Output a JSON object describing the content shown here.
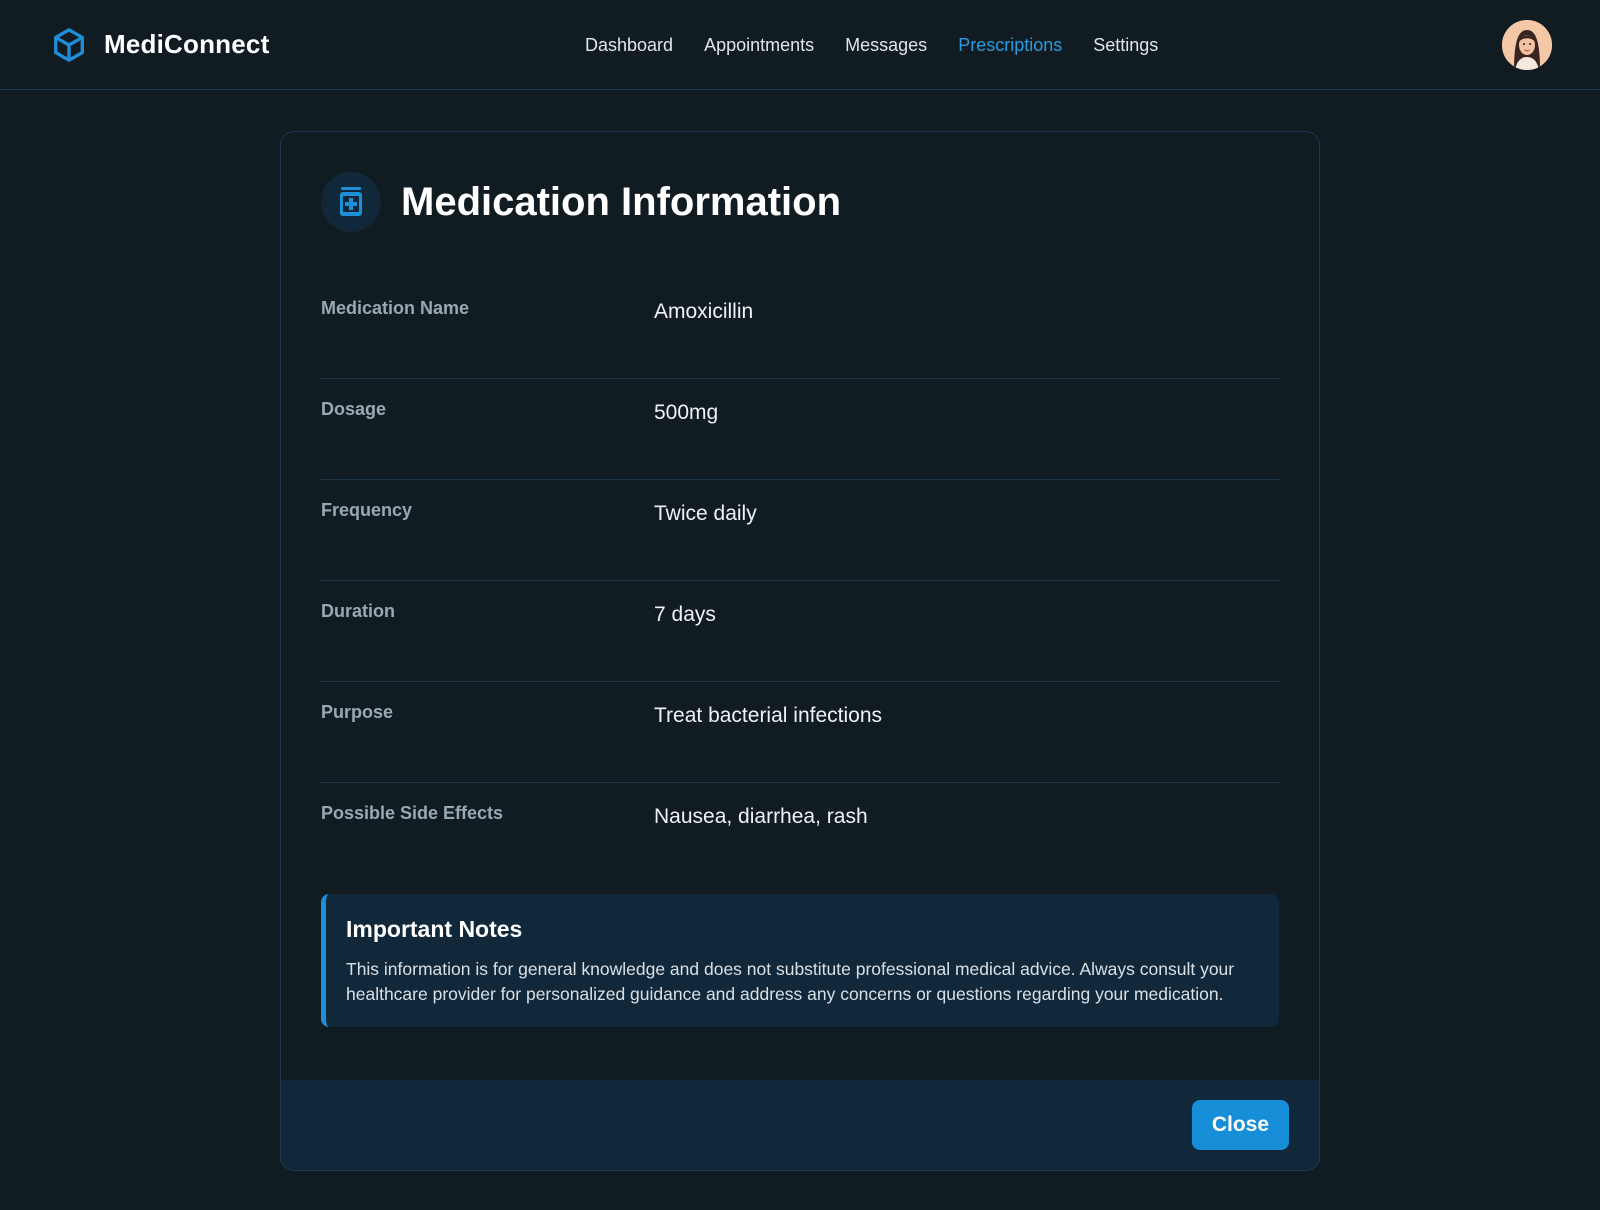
{
  "app": {
    "name": "MediConnect",
    "logo_icon": "cube-icon",
    "accent_color": "#1e8ed6"
  },
  "nav": {
    "items": [
      {
        "label": "Dashboard",
        "active": false
      },
      {
        "label": "Appointments",
        "active": false
      },
      {
        "label": "Messages",
        "active": false
      },
      {
        "label": "Prescriptions",
        "active": true
      },
      {
        "label": "Settings",
        "active": false
      }
    ]
  },
  "user": {
    "avatar_icon": "user-avatar"
  },
  "modal": {
    "icon": "medicine-bottle-icon",
    "title": "Medication Information",
    "fields": [
      {
        "label": "Medication Name",
        "value": "Amoxicillin"
      },
      {
        "label": "Dosage",
        "value": "500mg"
      },
      {
        "label": "Frequency",
        "value": "Twice daily"
      },
      {
        "label": "Duration",
        "value": "7 days"
      },
      {
        "label": "Purpose",
        "value": "Treat bacterial infections"
      },
      {
        "label": "Possible Side Effects",
        "value": "Nausea, diarrhea, rash"
      }
    ],
    "notes": {
      "title": "Important Notes",
      "text": "This information is for general knowledge and does not substitute professional medical advice. Always consult your healthcare provider for personalized guidance and address any concerns or questions regarding your medication."
    },
    "close_label": "Close"
  }
}
